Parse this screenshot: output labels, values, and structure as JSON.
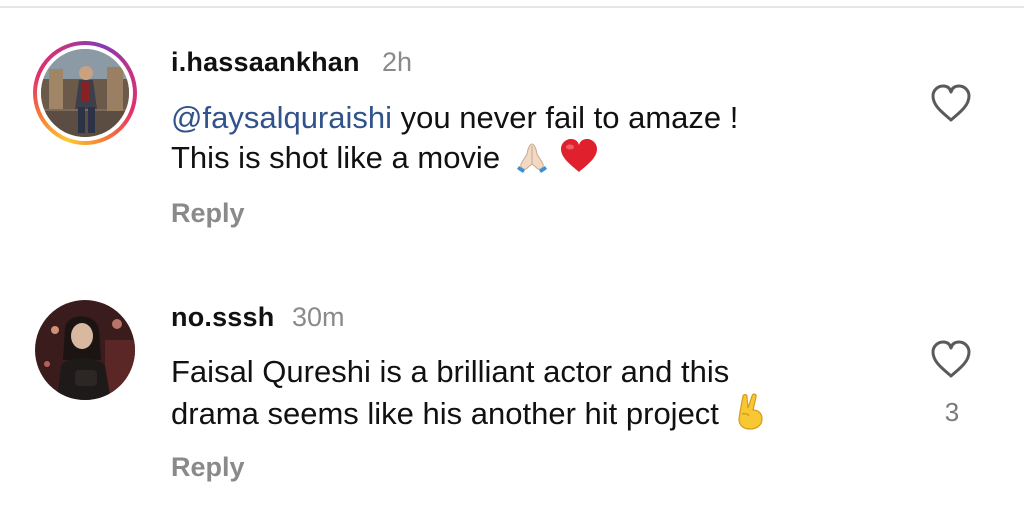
{
  "comments": [
    {
      "username": "i.hassaankhan",
      "time": "2h",
      "mention": "@faysalquraishi",
      "line1_rest": " you never fail to amaze !",
      "line2": "This is shot like a movie",
      "emojis": [
        "folded-hands-icon",
        "red-heart-icon"
      ],
      "reply_label": "Reply",
      "has_story_ring": true,
      "like_count": ""
    },
    {
      "username": "no.sssh",
      "time": "30m",
      "line1": "Faisal Qureshi is a brilliant actor and this",
      "line2": "drama seems like his another hit project",
      "emojis": [
        "victory-hand-icon"
      ],
      "reply_label": "Reply",
      "has_story_ring": false,
      "like_count": "3"
    }
  ],
  "colors": {
    "username": "#111111",
    "meta_grey": "#8a8a8a",
    "mention_blue": "#30538c",
    "heart_outline": "#5a5a5a"
  }
}
